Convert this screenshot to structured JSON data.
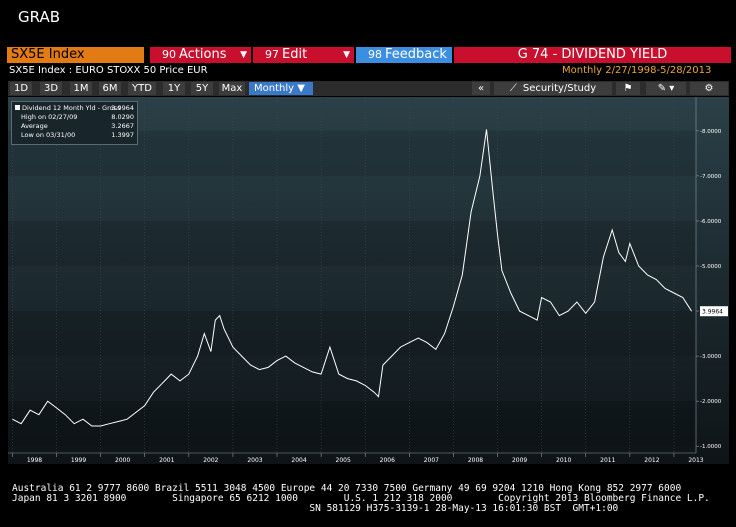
{
  "app": {
    "grab_label": "GRAB"
  },
  "header": {
    "ticker": "SX5E Index",
    "actions": {
      "num": "90",
      "label": "Actions"
    },
    "edit": {
      "num": "97",
      "label": "Edit"
    },
    "feedback": {
      "num": "98",
      "label": "Feedback"
    },
    "function": "G 74 - DIVIDEND YIELD",
    "security_desc": "SX5E Index : EURO STOXX 50 Price EUR",
    "period_range": "Monthly   2/27/1998-5/28/2013"
  },
  "toolbar": {
    "tabs": [
      "1D",
      "3D",
      "1M",
      "6M",
      "YTD",
      "1Y",
      "5Y",
      "Max"
    ],
    "period": "Monthly ▼",
    "collapse": "«",
    "security_study": "Security/Study"
  },
  "legend": {
    "series_label": "Dividend 12 Month Yld - Gross",
    "series_value": "3.9964",
    "high_label": "High on 02/27/09",
    "high_value": "8.0290",
    "avg_label": "Average",
    "avg_value": "3.2667",
    "low_label": "Low on 03/31/00",
    "low_value": "1.3997"
  },
  "colors": {
    "accent_orange": "#e27a16",
    "function_red": "#c8102e",
    "feedback_blue": "#3c8fe0",
    "line": "#ffffff"
  },
  "chart_data": {
    "type": "line",
    "series": [
      {
        "name": "Dividend 12 Month Yld - Gross",
        "x": [
          1998.0,
          1998.2,
          1998.4,
          1998.6,
          1998.8,
          1999.0,
          1999.2,
          1999.4,
          1999.6,
          1999.8,
          2000.0,
          2000.2,
          2000.4,
          2000.6,
          2000.8,
          2001.0,
          2001.2,
          2001.4,
          2001.6,
          2001.8,
          2002.0,
          2002.2,
          2002.35,
          2002.5,
          2002.6,
          2002.7,
          2002.8,
          2003.0,
          2003.2,
          2003.4,
          2003.6,
          2003.8,
          2004.0,
          2004.2,
          2004.4,
          2004.6,
          2004.8,
          2005.0,
          2005.2,
          2005.4,
          2005.6,
          2005.8,
          2006.0,
          2006.2,
          2006.3,
          2006.4,
          2006.6,
          2006.8,
          2007.0,
          2007.2,
          2007.4,
          2007.6,
          2007.8,
          2008.0,
          2008.2,
          2008.4,
          2008.6,
          2008.75,
          2008.9,
          2009.0,
          2009.1,
          2009.3,
          2009.5,
          2009.7,
          2009.9,
          2010.0,
          2010.2,
          2010.4,
          2010.6,
          2010.8,
          2011.0,
          2011.2,
          2011.4,
          2011.6,
          2011.75,
          2011.9,
          2012.0,
          2012.2,
          2012.4,
          2012.6,
          2012.8,
          2013.0,
          2013.2,
          2013.4
        ],
        "y": [
          1.6,
          1.5,
          1.8,
          1.7,
          2.0,
          1.85,
          1.7,
          1.5,
          1.6,
          1.45,
          1.45,
          1.5,
          1.55,
          1.6,
          1.75,
          1.9,
          2.2,
          2.4,
          2.6,
          2.45,
          2.6,
          3.0,
          3.5,
          3.1,
          3.8,
          3.9,
          3.6,
          3.2,
          3.0,
          2.8,
          2.7,
          2.75,
          2.9,
          3.0,
          2.85,
          2.75,
          2.65,
          2.6,
          3.2,
          2.6,
          2.5,
          2.45,
          2.35,
          2.2,
          2.1,
          2.8,
          3.0,
          3.2,
          3.3,
          3.4,
          3.3,
          3.15,
          3.5,
          4.1,
          4.8,
          6.2,
          7.0,
          8.03,
          6.6,
          5.7,
          4.9,
          4.4,
          4.0,
          3.9,
          3.8,
          4.3,
          4.2,
          3.9,
          4.0,
          4.2,
          3.95,
          4.2,
          5.2,
          5.8,
          5.3,
          5.1,
          5.5,
          5.0,
          4.8,
          4.7,
          4.5,
          4.4,
          4.3,
          3.9964
        ]
      }
    ],
    "x_ticks": [
      "1998",
      "1999",
      "2000",
      "2001",
      "2002",
      "2003",
      "2004",
      "2005",
      "2006",
      "2007",
      "2008",
      "2009",
      "2010",
      "2011",
      "2012",
      "2013"
    ],
    "y_ticks": [
      "1.0000",
      "2.0000",
      "3.0000",
      "4.0000",
      "5.0000",
      "6.0000",
      "7.0000",
      "8.0000"
    ],
    "xlim": [
      1997.9,
      2013.5
    ],
    "ylim": [
      0.85,
      8.75
    ],
    "last_value": "3.9964"
  },
  "footer": {
    "line1": "Australia 61 2 9777 8600 Brazil 5511 3048 4500 Europe 44 20 7330 7500 Germany 49 69 9204 1210 Hong Kong 852 2977 6000",
    "line2": "Japan 81 3 3201 8900        Singapore 65 6212 1000        U.S. 1 212 318 2000        Copyright 2013 Bloomberg Finance L.P.",
    "line3": "                                                    SN 581129 H375-3139-1 28-May-13 16:01:30 BST  GMT+1:00"
  }
}
